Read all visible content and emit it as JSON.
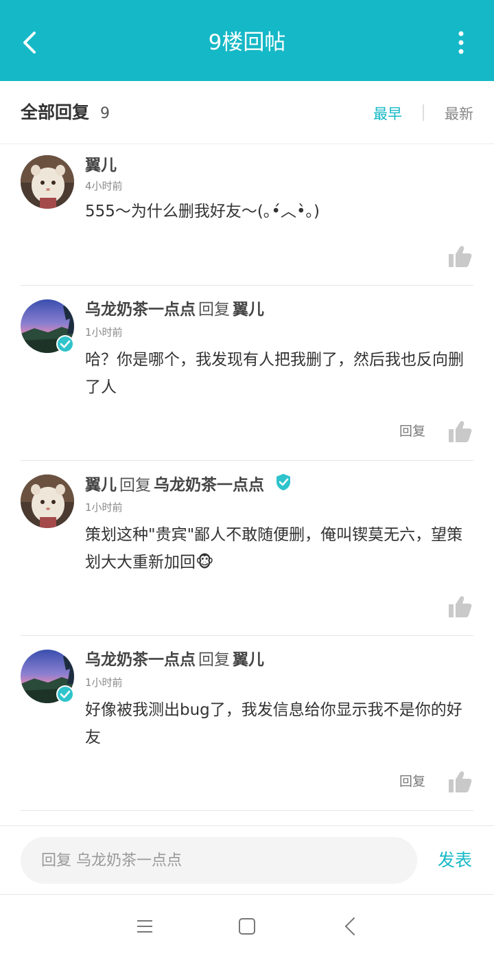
{
  "header": {
    "title": "9楼回帖",
    "back_icon": "back-arrow-icon",
    "more_icon": "more-vertical-icon",
    "bg_color": "#15b8c6"
  },
  "subheader": {
    "label": "全部回复",
    "count": "9",
    "sort_earliest": "最早",
    "sort_latest": "最新",
    "active_sort": "最早",
    "accent_color": "#15b8c6"
  },
  "replies": [
    {
      "author": "翼儿",
      "reply_word": "",
      "reply_to": "",
      "time": "4小时前",
      "content": "555～为什么删我好友～(｡•́︿•̀｡)",
      "show_reply_button": false,
      "avatar": "cat-avatar"
    },
    {
      "author": "乌龙奶茶一点点",
      "reply_word": "回复",
      "reply_to": "翼儿",
      "time": "1小时前",
      "content": "哈？你是哪个，我发现有人把我删了，然后我也反向删了人",
      "show_reply_button": true,
      "reply_label": "回复",
      "avatar": "landscape-avatar",
      "verified": true
    },
    {
      "author": "翼儿",
      "reply_word": "回复",
      "reply_to": "乌龙奶茶一点点",
      "time": "1小时前",
      "content": "策划这种\"贵宾\"鄙人不敢随便删，俺叫锲莫无六，望策划大大重新加回🐵",
      "show_reply_button": false,
      "avatar": "cat-avatar",
      "reply_to_verified": true
    },
    {
      "author": "乌龙奶茶一点点",
      "reply_word": "回复",
      "reply_to": "翼儿",
      "time": "1小时前",
      "content": "好像被我测出bug了，我发信息给你显示我不是你的好友",
      "show_reply_button": true,
      "reply_label": "回复",
      "avatar": "landscape-avatar",
      "verified": true
    }
  ],
  "composer": {
    "placeholder": "回复 乌龙奶茶一点点",
    "send_label": "发表"
  },
  "navbar": {
    "menu_icon": "menu-icon",
    "home_icon": "home-square-icon",
    "back_icon": "nav-back-icon"
  }
}
